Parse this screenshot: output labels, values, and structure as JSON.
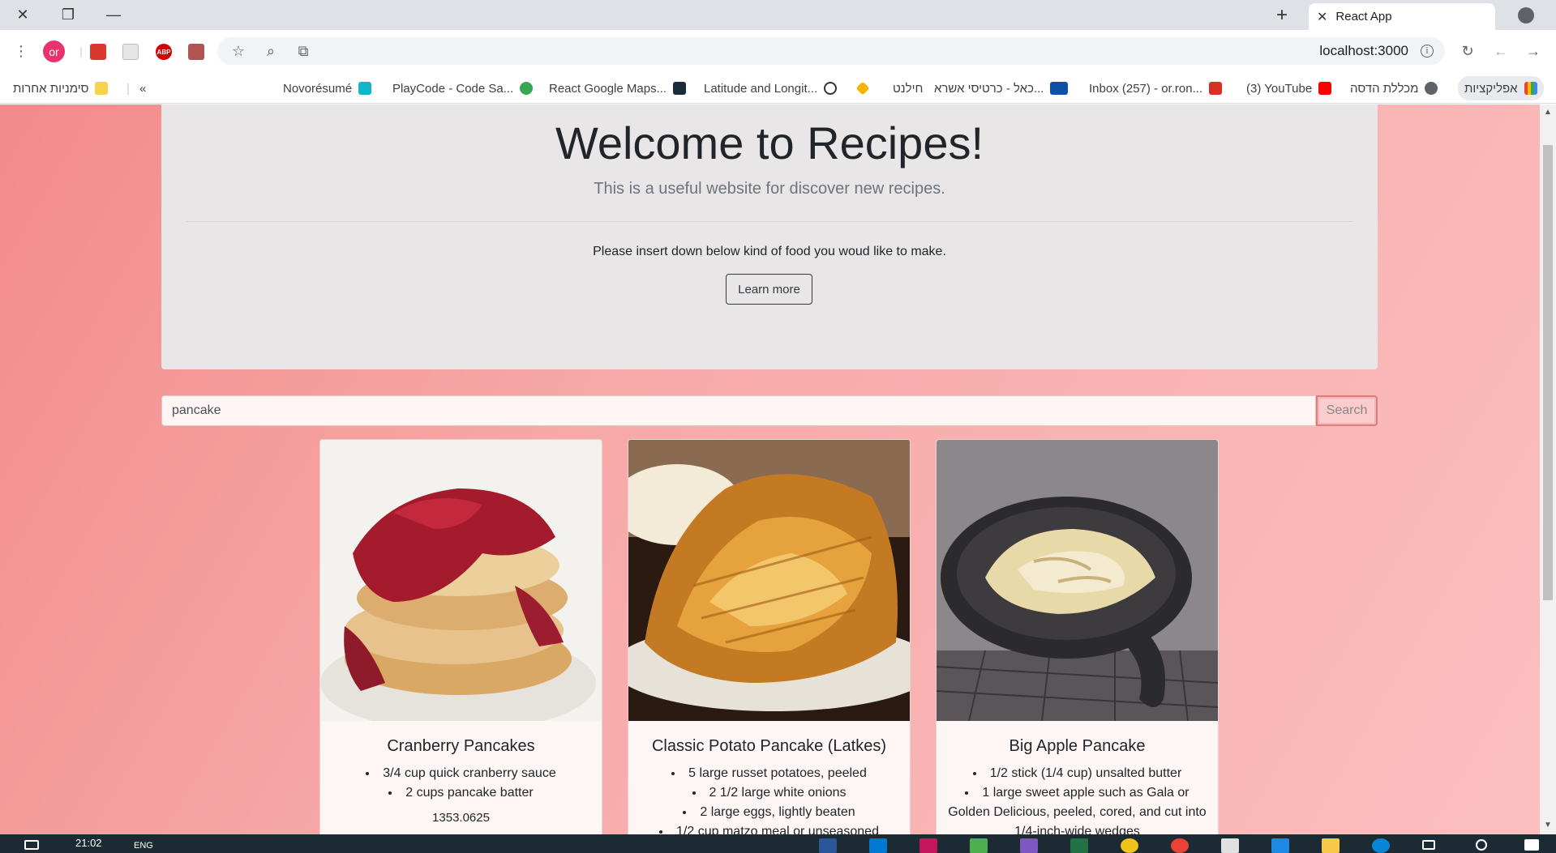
{
  "browser": {
    "tab_title": "React App",
    "url": "localhost:3000",
    "profile_initials": "or"
  },
  "bookmarks": [
    {
      "label": "אפליקציות",
      "icon": "apps-icon",
      "color": "#e8710a"
    },
    {
      "label": "מכללת הדסה",
      "icon": "globe-icon",
      "color": "#5f6368"
    },
    {
      "label": "(3) YouTube",
      "icon": "youtube-icon",
      "color": "#ff0000"
    },
    {
      "label": "Inbox (257) - or.ron...",
      "icon": "gmail-icon",
      "color": "#d93025"
    },
    {
      "label": "כאל - כרטיסי אשרא...",
      "icon": "cal-icon",
      "color": "#0f4fa8"
    },
    {
      "label": "חילנט",
      "icon": "diamond-icon",
      "color": "#f4b400"
    },
    {
      "label": "Latitude and Longit...",
      "icon": "compass-icon",
      "color": "#333333"
    },
    {
      "label": "React Google Maps...",
      "icon": "react-icon",
      "color": "#1a2b3c"
    },
    {
      "label": "PlayCode - Code Sa...",
      "icon": "playcode-icon",
      "color": "#34a853"
    },
    {
      "label": "Novorésumé",
      "icon": "novoresume-icon",
      "color": "#15b5c8"
    }
  ],
  "bookmarks_other": "סימניות אחרות",
  "overflow_chevron": "«",
  "page": {
    "title": "Welcome to Recipes!",
    "lead": "This is a useful website for discover new recipes.",
    "prompt": "Please insert down below kind of food you woud like to make.",
    "learn_more": "Learn more",
    "search_value": "pancake",
    "search_button": "Search"
  },
  "recipes": [
    {
      "title": "Cranberry Pancakes",
      "ingredients": [
        "3/4 cup quick cranberry sauce",
        "2 cups pancake batter"
      ],
      "calories": "1353.0625",
      "image": "cranberry-pancakes-photo"
    },
    {
      "title": "Classic Potato Pancake (Latkes)",
      "ingredients": [
        "5 large russet potatoes, peeled",
        "2 1/2 large white onions",
        "2 large eggs, lightly beaten",
        "1/2 cup matzo meal or unseasoned"
      ],
      "image": "potato-latkes-photo"
    },
    {
      "title": "Big Apple Pancake",
      "ingredients": [
        "1/2 stick (1/4 cup) unsalted butter",
        "1 large sweet apple such as Gala or Golden Delicious, peeled, cored, and cut into 1/4-inch-wide wedges"
      ],
      "image": "apple-pancake-skillet-photo"
    }
  ],
  "taskbar": {
    "time": "21:02",
    "lang": "ENG"
  }
}
